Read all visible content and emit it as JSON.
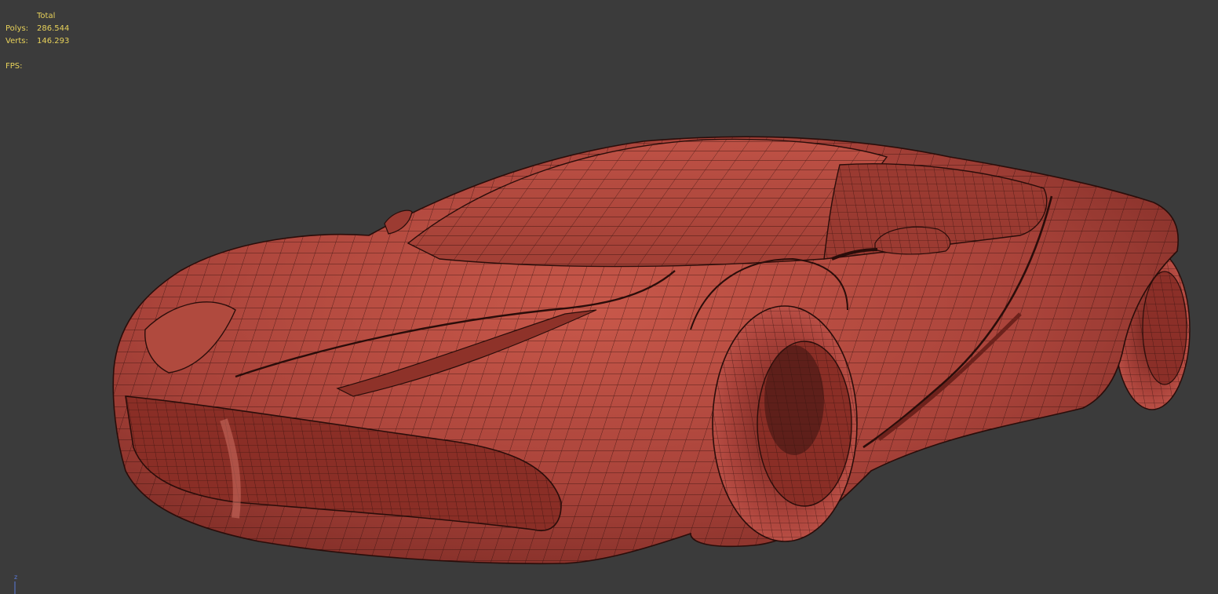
{
  "stats": {
    "header": "Total",
    "polys_label": "Polys:",
    "polys_value": "286.544",
    "verts_label": "Verts:",
    "verts_value": "146.293",
    "fps_label": "FPS:"
  },
  "axis": {
    "z_label": "z"
  },
  "colors": {
    "background": "#3b3b3b",
    "stats_text": "#e8d25a",
    "mesh_fill": "#b4473a",
    "wire": "#2a0d0a"
  }
}
